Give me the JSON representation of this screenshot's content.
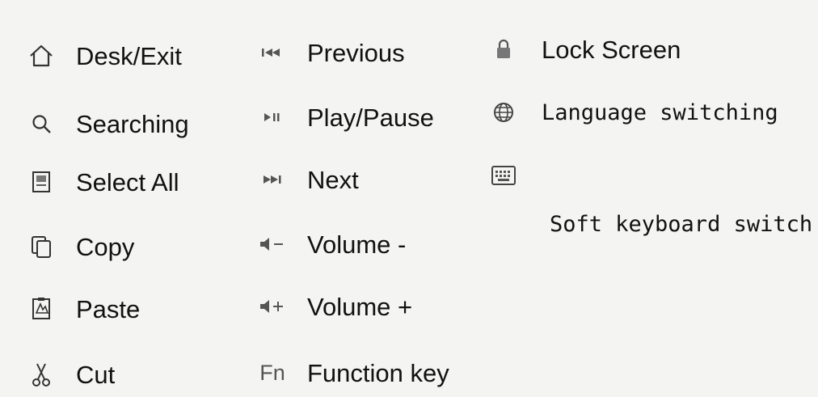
{
  "legend": {
    "column1": [
      {
        "icon": "home-icon",
        "label": "Desk/Exit"
      },
      {
        "icon": "search-icon",
        "label": "Searching"
      },
      {
        "icon": "select-all-icon",
        "label": "Select All"
      },
      {
        "icon": "copy-icon",
        "label": "Copy"
      },
      {
        "icon": "paste-icon",
        "label": "Paste"
      },
      {
        "icon": "scissors-icon",
        "label": "Cut"
      }
    ],
    "column2": [
      {
        "icon": "previous-icon",
        "label": "Previous"
      },
      {
        "icon": "play-pause-icon",
        "label": "Play/Pause"
      },
      {
        "icon": "next-icon",
        "label": "Next"
      },
      {
        "icon": "volume-down-icon",
        "label": "Volume -"
      },
      {
        "icon": "volume-up-icon",
        "label": "Volume +"
      },
      {
        "icon": "function-key-icon",
        "glyph": "Fn",
        "label": "Function key"
      }
    ],
    "column3": [
      {
        "icon": "lock-icon",
        "label": "Lock Screen"
      },
      {
        "icon": "globe-icon",
        "label": "Language switching"
      },
      {
        "icon": "keyboard-icon",
        "label": "Soft keyboard switch"
      }
    ]
  }
}
